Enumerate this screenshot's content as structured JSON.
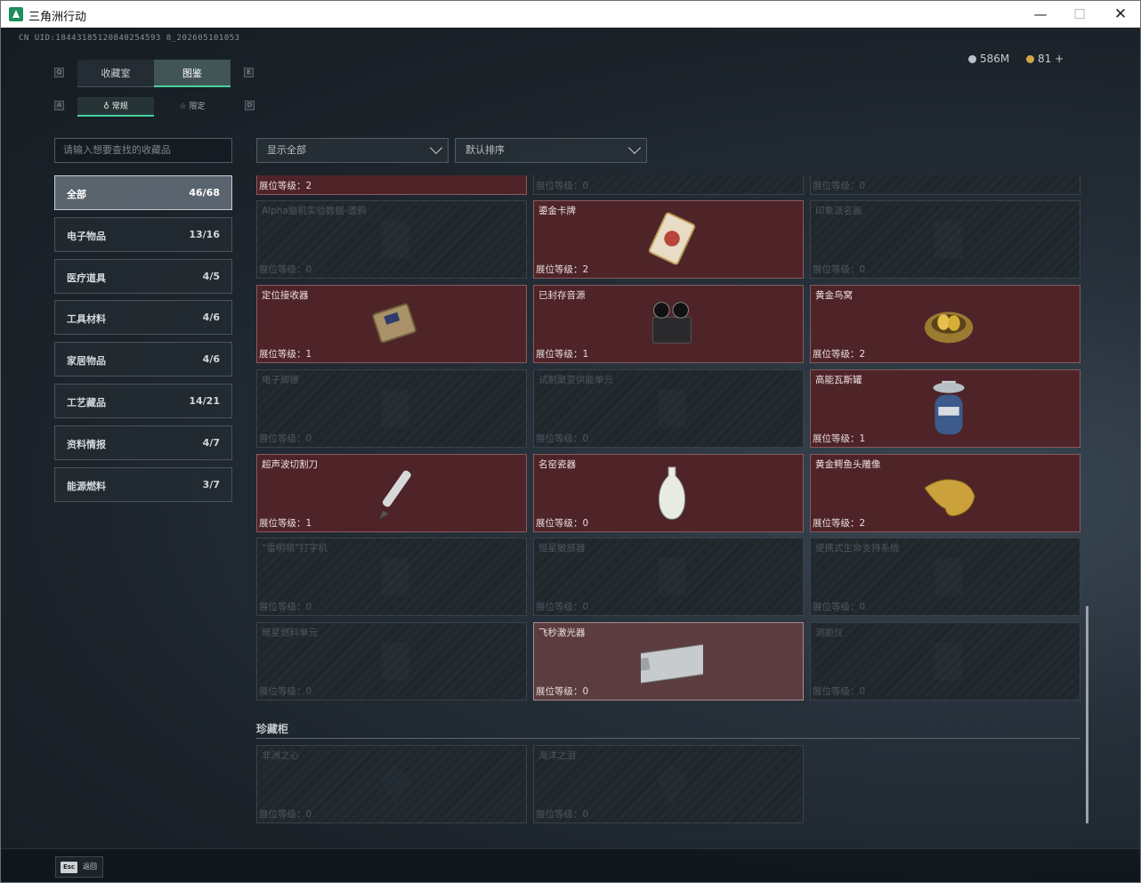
{
  "window": {
    "title": "三角洲行动"
  },
  "header": {
    "uid": "CN UID:18443185120840254593 8_202605101053",
    "currency": [
      {
        "label": "586M",
        "color": "#b9c2c9"
      },
      {
        "label": "81 +",
        "color": "#d1a64a"
      }
    ]
  },
  "tabs": [
    {
      "label": "收藏室",
      "active": false
    },
    {
      "label": "图鉴",
      "active": true
    }
  ],
  "subtabs": [
    {
      "label": "常规",
      "active": true
    },
    {
      "label": "限定",
      "active": false
    }
  ],
  "key_hints": {
    "tab_prev": "Q",
    "tab_next": "E",
    "sub_prev": "A",
    "sub_next": "D"
  },
  "search": {
    "placeholder": "请输入想要查找的收藏品"
  },
  "filters": {
    "show": "显示全部",
    "sort": "默认排序"
  },
  "categories": [
    {
      "label": "全部",
      "count": "46/68",
      "active": true
    },
    {
      "label": "电子物品",
      "count": "13/16"
    },
    {
      "label": "医疗道具",
      "count": "4/5"
    },
    {
      "label": "工具材料",
      "count": "4/6"
    },
    {
      "label": "家居物品",
      "count": "4/6"
    },
    {
      "label": "工艺藏品",
      "count": "14/21"
    },
    {
      "label": "资料情报",
      "count": "4/7"
    },
    {
      "label": "能源燃料",
      "count": "3/7"
    }
  ],
  "items": [
    {
      "name": "",
      "level": "展位等级：2",
      "state": "owned",
      "icon": "gold-coin-icon"
    },
    {
      "name": "",
      "level": "展位等级：0",
      "state": "locked",
      "icon": "item-silhouette-icon"
    },
    {
      "name": "",
      "level": "展位等级：0",
      "state": "locked",
      "icon": "item-silhouette-icon"
    },
    {
      "name": "Alpha脑机实验数据-遗鸦",
      "level": "展位等级：0",
      "state": "locked",
      "icon": "data-drive-icon"
    },
    {
      "name": "鎏金卡牌",
      "level": "展位等级：2",
      "state": "owned",
      "icon": "gilded-card-icon"
    },
    {
      "name": "印象派名画",
      "level": "展位等级：0",
      "state": "locked",
      "icon": "painting-icon"
    },
    {
      "name": "定位接收器",
      "level": "展位等级：1",
      "state": "owned",
      "icon": "gps-receiver-icon"
    },
    {
      "name": "已封存音源",
      "level": "展位等级：1",
      "state": "owned",
      "icon": "tape-recorder-icon"
    },
    {
      "name": "黄金鸟窝",
      "level": "展位等级：2",
      "state": "owned",
      "icon": "golden-nest-icon"
    },
    {
      "name": "电子脚镣",
      "level": "展位等级：0",
      "state": "locked",
      "icon": "ankle-monitor-icon"
    },
    {
      "name": "试制聚变供能单元",
      "level": "展位等级：0",
      "state": "locked",
      "icon": "fusion-cell-icon"
    },
    {
      "name": "高能瓦斯罐",
      "level": "展位等级：1",
      "state": "owned",
      "icon": "gas-canister-icon"
    },
    {
      "name": "超声波切割刀",
      "level": "展位等级：1",
      "state": "owned",
      "icon": "ultrasonic-cutter-icon"
    },
    {
      "name": "名窑瓷器",
      "level": "展位等级：0",
      "state": "owned",
      "icon": "porcelain-vase-icon"
    },
    {
      "name": "黄金鳄鱼头雕像",
      "level": "展位等级：2",
      "state": "owned",
      "icon": "golden-crocodile-icon"
    },
    {
      "name": "“雷明顿”打字机",
      "level": "展位等级：0",
      "state": "locked",
      "icon": "typewriter-icon"
    },
    {
      "name": "恒星敏感器",
      "level": "展位等级：0",
      "state": "locked",
      "icon": "star-sensor-icon"
    },
    {
      "name": "便携式生命支持系统",
      "level": "展位等级：0",
      "state": "locked",
      "icon": "life-support-icon"
    },
    {
      "name": "暗星燃料单元",
      "level": "展位等级：0",
      "state": "locked",
      "icon": "fuel-cell-icon"
    },
    {
      "name": "飞秒激光器",
      "level": "展位等级：0",
      "state": "highlight",
      "icon": "femtosecond-laser-icon"
    },
    {
      "name": "测距仪",
      "level": "展位等级：0",
      "state": "locked",
      "icon": "rangefinder-icon"
    }
  ],
  "showcase": {
    "title": "珍藏柜",
    "items": [
      {
        "name": "非洲之心",
        "level": "展位等级：0",
        "state": "locked",
        "icon": "gem-icon"
      },
      {
        "name": "海洋之泪",
        "level": "展位等级：0",
        "state": "locked",
        "icon": "gem-icon"
      }
    ]
  },
  "footer": {
    "esc_key": "Esc",
    "back_label": "返回"
  }
}
